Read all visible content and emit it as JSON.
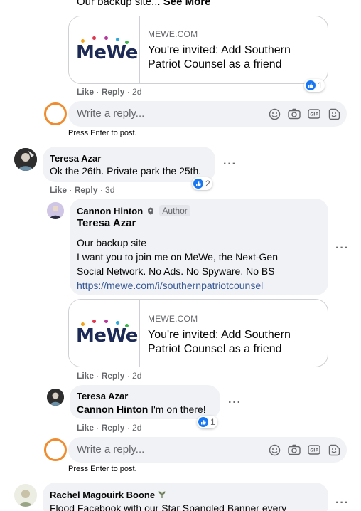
{
  "top_partial": {
    "text": "Our backup site...",
    "see_more": "See More"
  },
  "card1": {
    "domain": "MEWE.COM",
    "title": "You're invited: Add Southern Patriot Counsel as a friend",
    "logo": "MeWe",
    "reaction_count": "1"
  },
  "actions1": {
    "like": "Like",
    "reply": "Reply",
    "time": "2d"
  },
  "reply_box1": {
    "placeholder": "Write a reply...",
    "hint": "Press Enter to post."
  },
  "comment2": {
    "author": "Teresa Azar",
    "text": "Ok the 26th. Private park the 25th.",
    "reaction_count": "2",
    "like": "Like",
    "reply": "Reply",
    "time": "3d"
  },
  "reply3": {
    "author": "Cannon Hinton",
    "badge": "Author",
    "mention": "Teresa Azar",
    "lines": [
      "Our backup site",
      "I want you to join me on MeWe, the Next-Gen",
      "Social Network. No Ads. No Spyware. No BS"
    ],
    "link": "https://mewe.com/i/southernpatriotcounsel",
    "card": {
      "domain": "MEWE.COM",
      "title": "You're invited: Add Southern Patriot Counsel as a friend",
      "logo": "MeWe"
    },
    "like": "Like",
    "reply": "Reply",
    "time": "2d"
  },
  "reply4": {
    "author": "Teresa Azar",
    "mention": "Cannon Hinton",
    "text": "I'm on there!",
    "reaction_count": "1",
    "like": "Like",
    "reply": "Reply",
    "time": "2d"
  },
  "reply_box2": {
    "placeholder": "Write a reply...",
    "hint": "Press Enter to post."
  },
  "comment5": {
    "author": "Rachel Magouirk Boone",
    "text": "Flood Facebook with our Star Spangled Banner every"
  },
  "colors": {
    "accent": "#1877f2",
    "link": "#385898",
    "ring": "#f08c2e",
    "bubble": "#f0f2f5"
  }
}
